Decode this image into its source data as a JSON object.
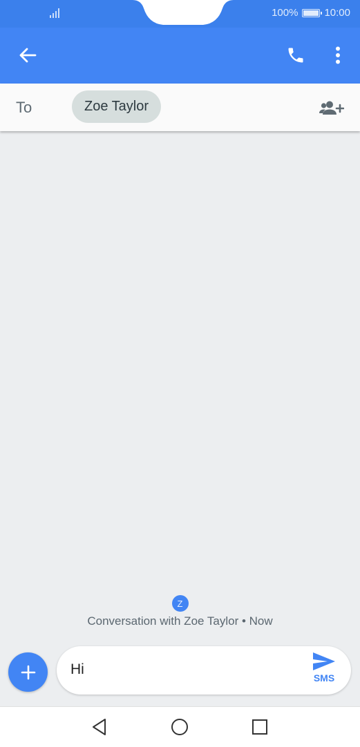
{
  "status_bar": {
    "battery_percent": "100%",
    "time": "10:00"
  },
  "app_bar": {
    "back_icon": "arrow-back-icon",
    "call_icon": "phone-icon",
    "more_icon": "more-vert-icon"
  },
  "recipient_bar": {
    "to_label": "To",
    "recipient_chip": "Zoe Taylor",
    "add_person_icon": "add-person-icon"
  },
  "conversation": {
    "avatar_initial": "Z",
    "info_text": "Conversation with Zoe Taylor • Now"
  },
  "compose": {
    "add_icon": "plus-icon",
    "message_value": "Hi",
    "send_icon": "send-icon",
    "send_label": "SMS"
  },
  "nav_bar": {
    "back_icon": "nav-back-icon",
    "home_icon": "nav-home-icon",
    "recents_icon": "nav-recents-icon"
  },
  "colors": {
    "primary": "#4285f4",
    "status_bar": "#3b80ec",
    "background": "#eceef0",
    "chip": "#d6dedd"
  }
}
